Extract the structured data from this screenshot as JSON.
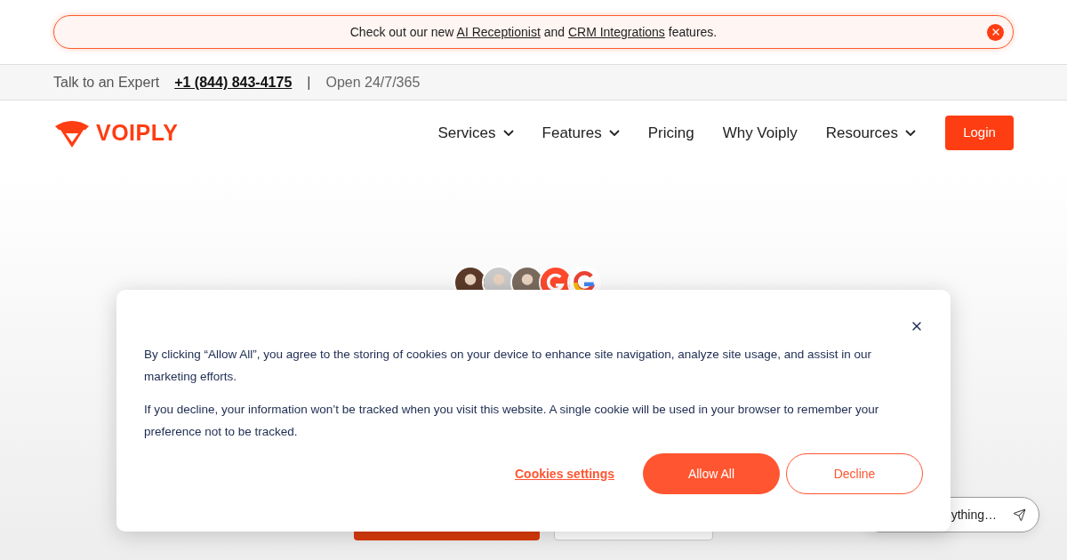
{
  "announcement": {
    "text_before": "Check out our new",
    "link_1": "AI Receptionist",
    "text_middle": "and",
    "link_2": "CRM Integrations",
    "text_after": "features."
  },
  "topbar": {
    "label": "Talk to an Expert",
    "phone": "+1 (844) 843-4175",
    "separator": "|",
    "hours": "Open 24/7/365"
  },
  "brand": {
    "name": "VOIPLY"
  },
  "nav": [
    {
      "label": "Services",
      "dropdown": true
    },
    {
      "label": "Features",
      "dropdown": true
    },
    {
      "label": "Pricing",
      "dropdown": false
    },
    {
      "label": "Why Voiply",
      "dropdown": false
    },
    {
      "label": "Resources",
      "dropdown": true
    }
  ],
  "login": "Login",
  "hero": {
    "badges": [
      {
        "kind": "avatar",
        "color": "#5b3a29"
      },
      {
        "kind": "avatar",
        "color": "#c9c9c9"
      },
      {
        "kind": "avatar",
        "color": "#7a6a5e"
      },
      {
        "kind": "g2"
      },
      {
        "kind": "google"
      }
    ]
  },
  "cookie": {
    "paragraphs": [
      "By clicking “Allow All”, you agree to the storing of cookies on your device to enhance site navigation, analyze site usage, and assist in our marketing efforts.",
      "If you decline, your information won’t be tracked when you visit this website. A single cookie will be used in your browser to remember your preference not to be tracked."
    ],
    "settings": "Cookies settings",
    "allow": "Allow All",
    "decline": "Decline"
  },
  "chat": {
    "placeholder": "ything…"
  }
}
